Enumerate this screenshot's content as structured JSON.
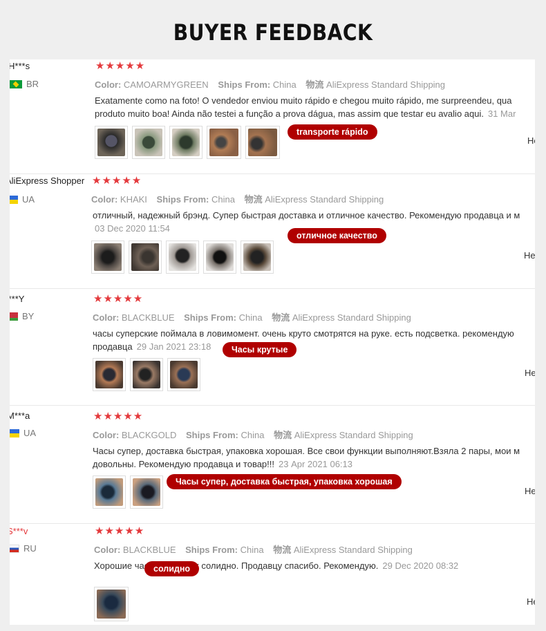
{
  "page": {
    "title": "BUYER FEEDBACK"
  },
  "labels": {
    "color": "Color:",
    "ships_from": "Ships From:",
    "shipping": "物流"
  },
  "reviews": [
    {
      "name": "H***s",
      "country": "BR",
      "stars": "★★★★★",
      "color": "CAMOARMYGREEN",
      "ships_from": "China",
      "shipping": "AliExpress Standard Shipping",
      "text1": "Exatamente como na foto! O vendedor enviou muito rápido e chegou muito rápido, me surpreendeu, qua",
      "text2": "produto muito boa! Ainda não testei a função a prova dágua, mas assim que testar eu avalio aqui.",
      "date": "31 Mar",
      "tag": "transporte rápido",
      "helpful": "He"
    },
    {
      "name": "AliExpress Shopper",
      "country": "UA",
      "stars": "★★★★★",
      "color": "KHAKI",
      "ships_from": "China",
      "shipping": "AliExpress Standard Shipping",
      "text1": "отличный, надежный брэнд. Супер быстрая доставка и отличное качество. Рекомендую продавца и м",
      "text2": "",
      "date": "03 Dec 2020 11:54",
      "tag": "отличное качество",
      "helpful": "Не"
    },
    {
      "name": ".***Y",
      "country": "BY",
      "stars": "★★★★★",
      "color": "BLACKBLUE",
      "ships_from": "China",
      "shipping": "AliExpress Standard Shipping",
      "text1": "часы суперские поймала в ловимомент. очень круто смотрятся на руке. есть подсветка. рекомендую",
      "text2": "продавца",
      "date": "29 Jan 2021 23:18",
      "tag": "Часы крутые",
      "helpful": "Не"
    },
    {
      "name": "M***a",
      "country": "UA",
      "stars": "★★★★★",
      "color": "BLACKGOLD",
      "ships_from": "China",
      "shipping": "AliExpress Standard Shipping",
      "text1": "Часы супер, доставка быстрая, упаковка хорошая. Все свои функции выполняют.Взяла 2 пары, мои м",
      "text2": "довольны. Рекомендую продавца и товар!!!",
      "date": "23 Apr 2021 06:13",
      "tag": "Часы супер, доставка быстрая, упаковка хорошая",
      "helpful": "Не"
    },
    {
      "name": "S***v",
      "country": "RU",
      "stars": "★★★★★",
      "color": "BLACKBLUE",
      "ships_from": "China",
      "shipping": "AliExpress Standard Shipping",
      "text1": "Хорошие часы, выглядят солидно. Продавцу спасибо. Рекомендую.",
      "text2": "",
      "date": "29 Dec 2020 08:32",
      "tag": "солидно",
      "helpful": "Не"
    }
  ]
}
